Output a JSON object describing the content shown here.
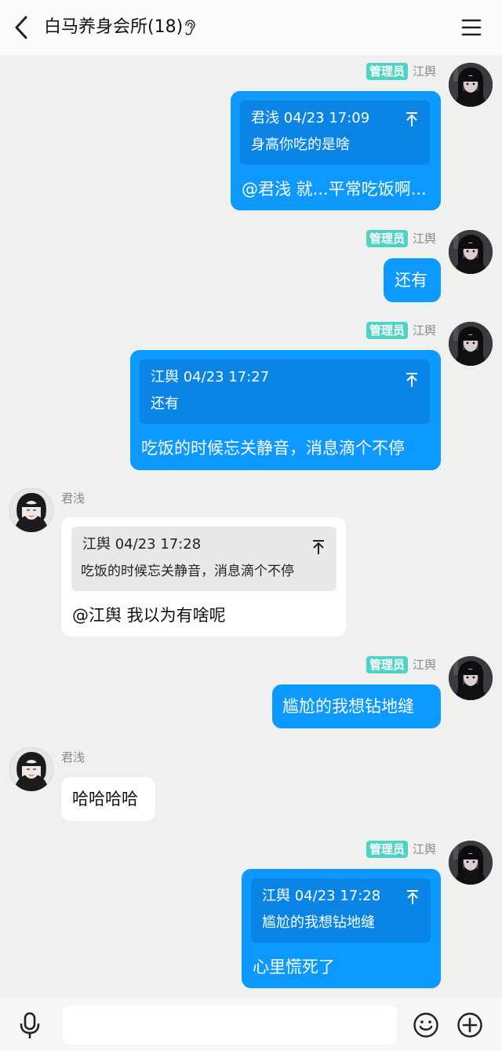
{
  "header": {
    "title": "白马养身会所(18)",
    "back_icon": "chevron-left-icon",
    "ear_icon": "ear-icon",
    "menu_icon": "hamburger-menu-icon"
  },
  "colors": {
    "outgoing_bubble": "#0d99ff",
    "quote_outgoing": "#0a85e6",
    "incoming_bubble": "#ffffff",
    "admin_badge": "#4fd3c7",
    "background": "#eef1ee"
  },
  "messages": [
    {
      "direction": "out",
      "badge": "管理员",
      "sender": "江舆",
      "quote": {
        "header": "君浅 04/23 17:09",
        "body": "身高你吃的是啥"
      },
      "text": "@君浅 就...平常吃饭啊..."
    },
    {
      "direction": "out",
      "badge": "管理员",
      "sender": "江舆",
      "text": "还有"
    },
    {
      "direction": "out",
      "badge": "管理员",
      "sender": "江舆",
      "quote": {
        "header": "江舆 04/23 17:27",
        "body": "还有"
      },
      "text": "吃饭的时候忘关静音，消息滴个不停"
    },
    {
      "direction": "in",
      "sender": "君浅",
      "quote": {
        "header": "江舆 04/23 17:28",
        "body": "吃饭的时候忘关静音，消息滴个不停"
      },
      "text": "@江舆 我以为有啥呢"
    },
    {
      "direction": "out",
      "badge": "管理员",
      "sender": "江舆",
      "text": "尴尬的我想钻地缝"
    },
    {
      "direction": "in",
      "sender": "君浅",
      "text": "哈哈哈哈"
    },
    {
      "direction": "out",
      "badge": "管理员",
      "sender": "江舆",
      "quote": {
        "header": "江舆 04/23 17:28",
        "body": "尴尬的我想钻地缝"
      },
      "text": "心里慌死了"
    }
  ],
  "input": {
    "placeholder": "",
    "value": ""
  },
  "bottom_bar": {
    "mic_icon": "microphone-icon",
    "emoji_icon": "emoji-icon",
    "plus_icon": "plus-circle-icon"
  }
}
